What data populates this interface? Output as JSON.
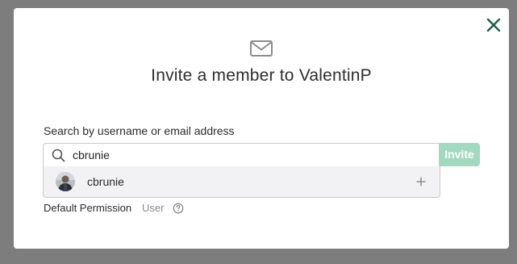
{
  "dialog": {
    "title": "Invite a member to ValentinP",
    "header_icon": "envelope-icon",
    "close_icon": "close-icon"
  },
  "search": {
    "label": "Search by username or email address",
    "value": "cbrunie",
    "icon": "search-icon",
    "invite_label": "Invite"
  },
  "results": [
    {
      "name": "cbrunie",
      "action_icon": "plus-icon"
    }
  ],
  "permission": {
    "label": "Default Permission",
    "value": "User",
    "help_icon": "help-circle-icon"
  },
  "colors": {
    "accent": "#1f5c45",
    "invite_disabled": "#a3d9c0",
    "backdrop": "#7d7d7d"
  }
}
